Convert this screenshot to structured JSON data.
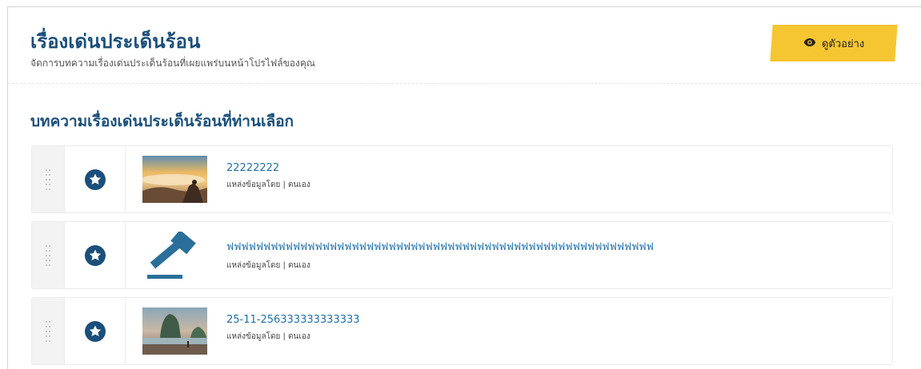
{
  "header": {
    "title": "เรื่องเด่นประเด็นร้อน",
    "subtitle": "จัดการบทความเรื่องเด่นประเด็นร้อนที่เผยแพร่บนหน้าโปรไฟล์ของคุณ",
    "preview_label": "ดูตัวอย่าง",
    "preview_icon": "eye-icon"
  },
  "section": {
    "title": "บทความเรื่องเด่นประเด็นร้อนที่ท่านเลือก"
  },
  "articles": [
    {
      "title": "22222222",
      "source": "แหล่งข้อมูลโดย | ตนเอง",
      "thumbnail": "sunrise-mountain-photo",
      "star_icon": "star-icon"
    },
    {
      "title": "ฟฟฟฟฟฟฟฟฟฟฟฟฟฟฟฟฟฟฟฟฟฟฟฟฟฟฟฟฟฟฟฟฟฟฟฟฟฟฟฟฟฟฟฟฟฟฟฟฟฟฟฟฟฟฟฟฟฟ",
      "source": "แหล่งข้อมูลโดย | ตนเอง",
      "thumbnail": "gavel-icon",
      "star_icon": "star-icon"
    },
    {
      "title": "25-11-256333333333333",
      "source": "แหล่งข้อมูลโดย | ตนเอง",
      "thumbnail": "beach-sunset-photo",
      "star_icon": "star-icon"
    }
  ],
  "colors": {
    "primary": "#1b4f7a",
    "link": "#1f6fa8",
    "accent": "#f6c532"
  }
}
